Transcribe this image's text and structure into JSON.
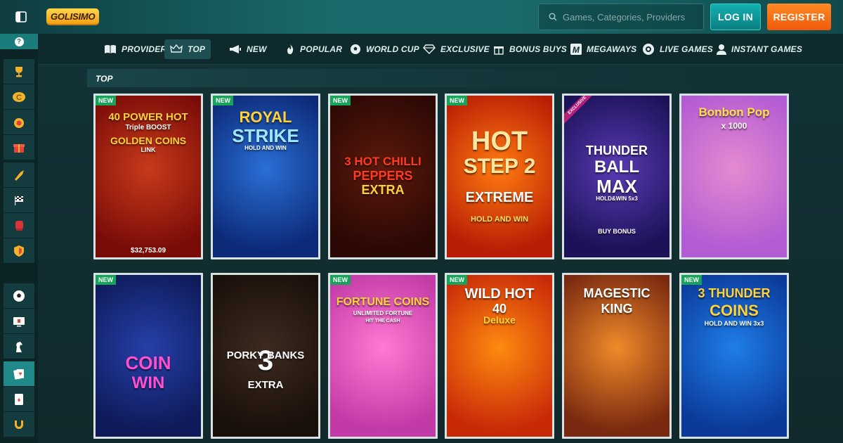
{
  "header": {
    "logo": "GOLISIMO",
    "search_placeholder": "Games, Categories, Providers",
    "login_label": "LOG IN",
    "register_label": "REGISTER"
  },
  "rail": {
    "help_label": "?",
    "items": [
      "trophy-icon",
      "coin-c-icon",
      "medal-icon",
      "gift-icon",
      "trumpet-icon",
      "flags-icon",
      "boxing-glove-icon",
      "shield-icon",
      "soccer-ball-icon",
      "card-screen-icon",
      "horse-icon",
      "cards-icon",
      "playing-card-icon",
      "horseshoe-icon"
    ],
    "active_index": 11
  },
  "nav": {
    "items": [
      {
        "label": "PROVIDERS",
        "icon": "book-icon"
      },
      {
        "label": "TOP",
        "icon": "crown-icon",
        "active": true
      },
      {
        "label": "NEW",
        "icon": "megaphone-icon"
      },
      {
        "label": "POPULAR",
        "icon": "flame-icon"
      },
      {
        "label": "WORLD CUP",
        "icon": "soccer-ball-icon"
      },
      {
        "label": "EXCLUSIVE",
        "icon": "diamond-icon"
      },
      {
        "label": "BONUS BUYS",
        "icon": "gift-icon"
      },
      {
        "label": "MEGAWAYS",
        "icon": "megaways-m-icon"
      },
      {
        "label": "LIVE GAMES",
        "icon": "live-chip-icon"
      },
      {
        "label": "INSTANT GAMES",
        "icon": "user-icon"
      }
    ]
  },
  "section": {
    "title": "TOP"
  },
  "games": [
    {
      "title": "40 POWER HOT",
      "subtitle": "Triple BOOST",
      "line3": "GOLDEN COINS",
      "line4": "LINK",
      "badge": "NEW",
      "jackpot": "$32,753.09",
      "bg": [
        "#c83a1a",
        "#7a0c08"
      ]
    },
    {
      "title": "ROYAL",
      "subtitle": "STRIKE",
      "line3": "HOLD AND WIN",
      "badge": "NEW",
      "bg": [
        "#2a6fd6",
        "#0c2a78"
      ]
    },
    {
      "title": "3 HOT CHILLI",
      "subtitle": "PEPPERS",
      "line3": "EXTRA",
      "badge": "NEW",
      "bg": [
        "#5a1a0c",
        "#2c0804"
      ]
    },
    {
      "title": "HOT",
      "subtitle": "STEP 2",
      "line3": "EXTREME",
      "line4": "HOLD AND WIN",
      "badge": "NEW",
      "bg": [
        "#ff7b10",
        "#b81e05"
      ]
    },
    {
      "title": "THUNDER",
      "subtitle": "BALL",
      "line3": "MAX",
      "line4": "HOLD&WIN 5x3",
      "extra": "BUY BONUS",
      "badge": "EXCLUSIVE",
      "bg": [
        "#5a3ab4",
        "#1c1258"
      ]
    },
    {
      "title": "Bonbon Pop",
      "subtitle": "x 1000",
      "bg": [
        "#e58ad0",
        "#b35bd3"
      ]
    },
    {
      "title": "COIN",
      "subtitle": "WIN",
      "badge": "NEW",
      "bg": [
        "#2540a8",
        "#0f1a5a"
      ]
    },
    {
      "title": "3",
      "subtitle": "PORKY BANKS",
      "line3": "EXTRA",
      "bg": [
        "#3d2a20",
        "#1a100a"
      ]
    },
    {
      "title": "FORTUNE COINS",
      "subtitle": "UNLIMITED FORTUNE",
      "line3": "HIT THE CASH",
      "badge": "NEW",
      "bg": [
        "#ff7ad2",
        "#c23aa6"
      ]
    },
    {
      "title": "WILD HOT",
      "subtitle": "40",
      "line3": "Deluxe",
      "badge": "NEW",
      "bg": [
        "#ff8a10",
        "#c82a08"
      ]
    },
    {
      "title": "MAGESTIC",
      "subtitle": "KING",
      "bg": [
        "#f08a2a",
        "#7a2a10"
      ]
    },
    {
      "title": "3 THUNDER",
      "subtitle": "COINS",
      "line3": "HOLD AND WIN 3x3",
      "badge": "NEW",
      "bg": [
        "#1f7ee8",
        "#0b3a9a"
      ]
    }
  ]
}
